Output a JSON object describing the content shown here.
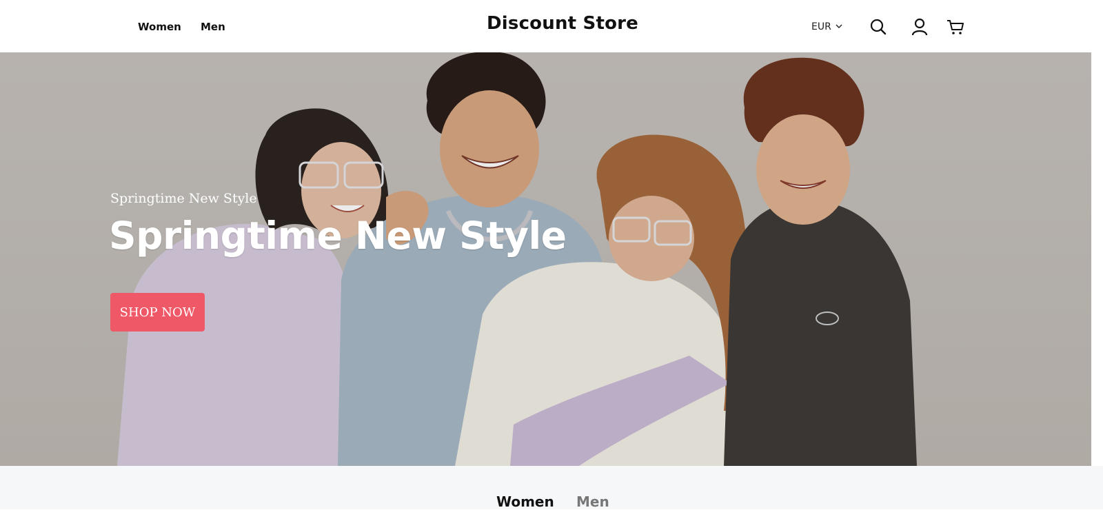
{
  "header": {
    "nav": [
      "Women",
      "Men"
    ],
    "logo": "Discount Store",
    "currency": "EUR",
    "icons": [
      "search-icon",
      "account-icon",
      "cart-icon",
      "chevron-down-icon"
    ]
  },
  "hero": {
    "subtitle": "Springtime New Style",
    "title": "Springtime New Style",
    "cta": "SHOP NOW",
    "cta_color": "#ef5867"
  },
  "below": {
    "tabs": [
      "Women",
      "Men"
    ]
  }
}
